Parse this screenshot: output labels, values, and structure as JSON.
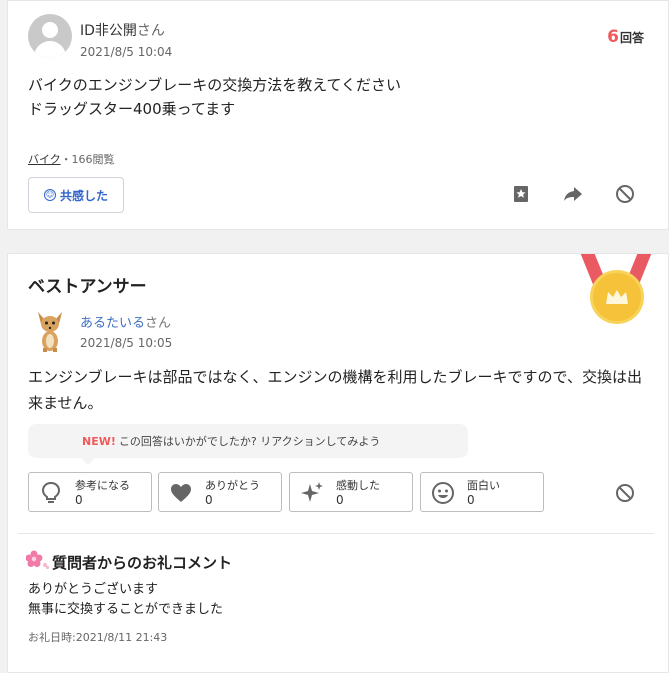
{
  "question": {
    "user_name": "ID非公開",
    "user_suffix": "さん",
    "timestamp": "2021/8/5 10:04",
    "answer_count": "6",
    "answer_count_label": "回答",
    "body": "バイクのエンジンブレーキの交換方法を教えてください\nドラッグスター400乗ってます",
    "category": "バイク",
    "views": "・166閲覧",
    "empathy_label": "共感した",
    "actions": [
      "bookmark-icon",
      "share-icon",
      "report-icon"
    ]
  },
  "best_answer": {
    "title": "ベストアンサー",
    "user_name": "あるたいる",
    "user_suffix": "さん",
    "timestamp": "2021/8/5 10:05",
    "body": "エンジンブレーキは部品ではなく、エンジンの機構を利用したブレーキですので、交換は出来ません。",
    "nudge_new": "NEW!",
    "nudge_text": "この回答はいかがでしたか? リアクションしてみよう",
    "reactions": [
      {
        "label": "参考になる",
        "count": "0",
        "icon": "lightbulb-icon"
      },
      {
        "label": "ありがとう",
        "count": "0",
        "icon": "heart-icon"
      },
      {
        "label": "感動した",
        "count": "0",
        "icon": "sparkle-icon"
      },
      {
        "label": "面白い",
        "count": "0",
        "icon": "smile-icon"
      }
    ],
    "thanks_title": "質問者からのお礼コメント",
    "thanks_text": "ありがとうございます\n無事に交換することができました",
    "thanks_date": "お礼日時:2021/8/11 21:43"
  },
  "colors": {
    "accent_red": "#f05a5a",
    "link_blue": "#3366cc",
    "medal_gold": "#f5c23a",
    "ribbon_red": "#ea5a62",
    "flower_pink": "#f07aa8"
  }
}
